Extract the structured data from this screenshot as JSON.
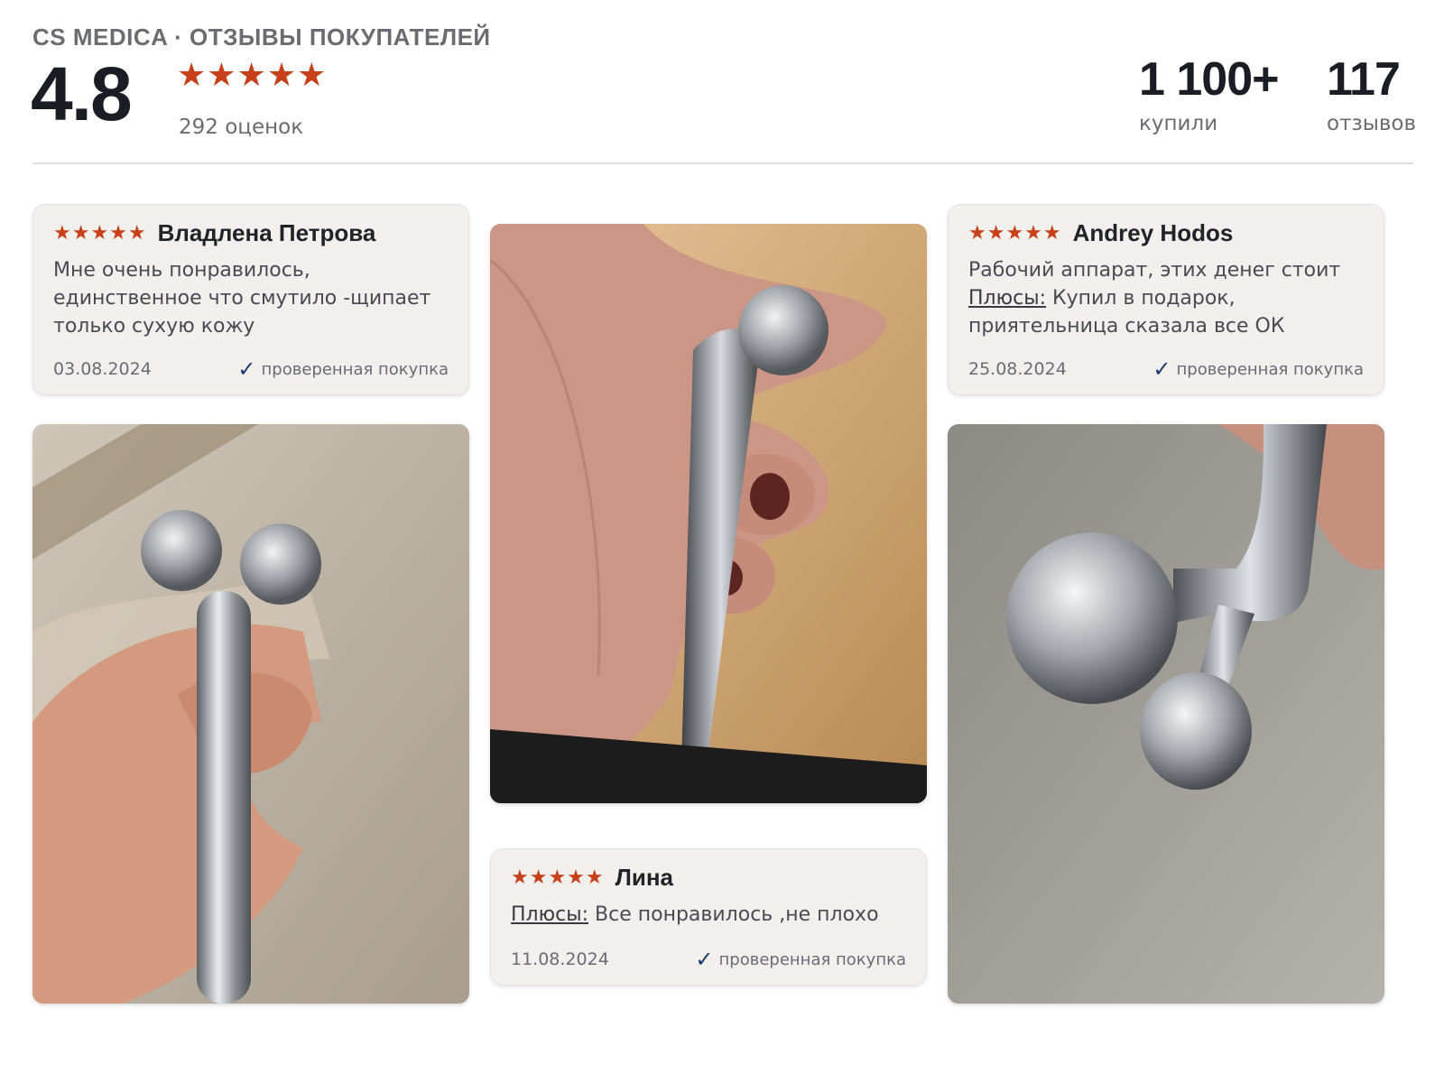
{
  "header": {
    "brand": "CS MEDICA · ОТЗЫВЫ ПОКУПАТЕЛЕЙ",
    "rating": "4.8",
    "stars": "★★★★★",
    "rating_count": "292 оценок",
    "stats": [
      {
        "value": "1 100+",
        "label": "купили"
      },
      {
        "value": "117",
        "label": "отзывов"
      }
    ]
  },
  "reviews": [
    {
      "stars": "★★★★★",
      "author": "Владлена Петрова",
      "text": "Мне очень понравилось, единственное что смутило -щипает только сухую кожу",
      "date": "03.08.2024",
      "verified": "проверенная покупка"
    },
    {
      "stars": "★★★★★",
      "author": "Andrey Hodos",
      "text_line1": "Рабочий аппарат, этих денег стоит",
      "pros_label": "Плюсы:",
      "text": "Купил в подарок, приятельница сказала все ОК",
      "date": "25.08.2024",
      "verified": "проверенная покупка"
    },
    {
      "stars": "★★★★★",
      "author": "Лина",
      "pros_label": "Плюсы:",
      "text": "Все понравилось ,не плохо",
      "date": "11.08.2024",
      "verified": "проверенная покупка"
    }
  ],
  "colors": {
    "accent_star": "#c8401a",
    "check": "#1d3a6e",
    "card_bg": "#f1f0ed"
  },
  "icons": [
    "star-icon",
    "checkmark-icon"
  ]
}
